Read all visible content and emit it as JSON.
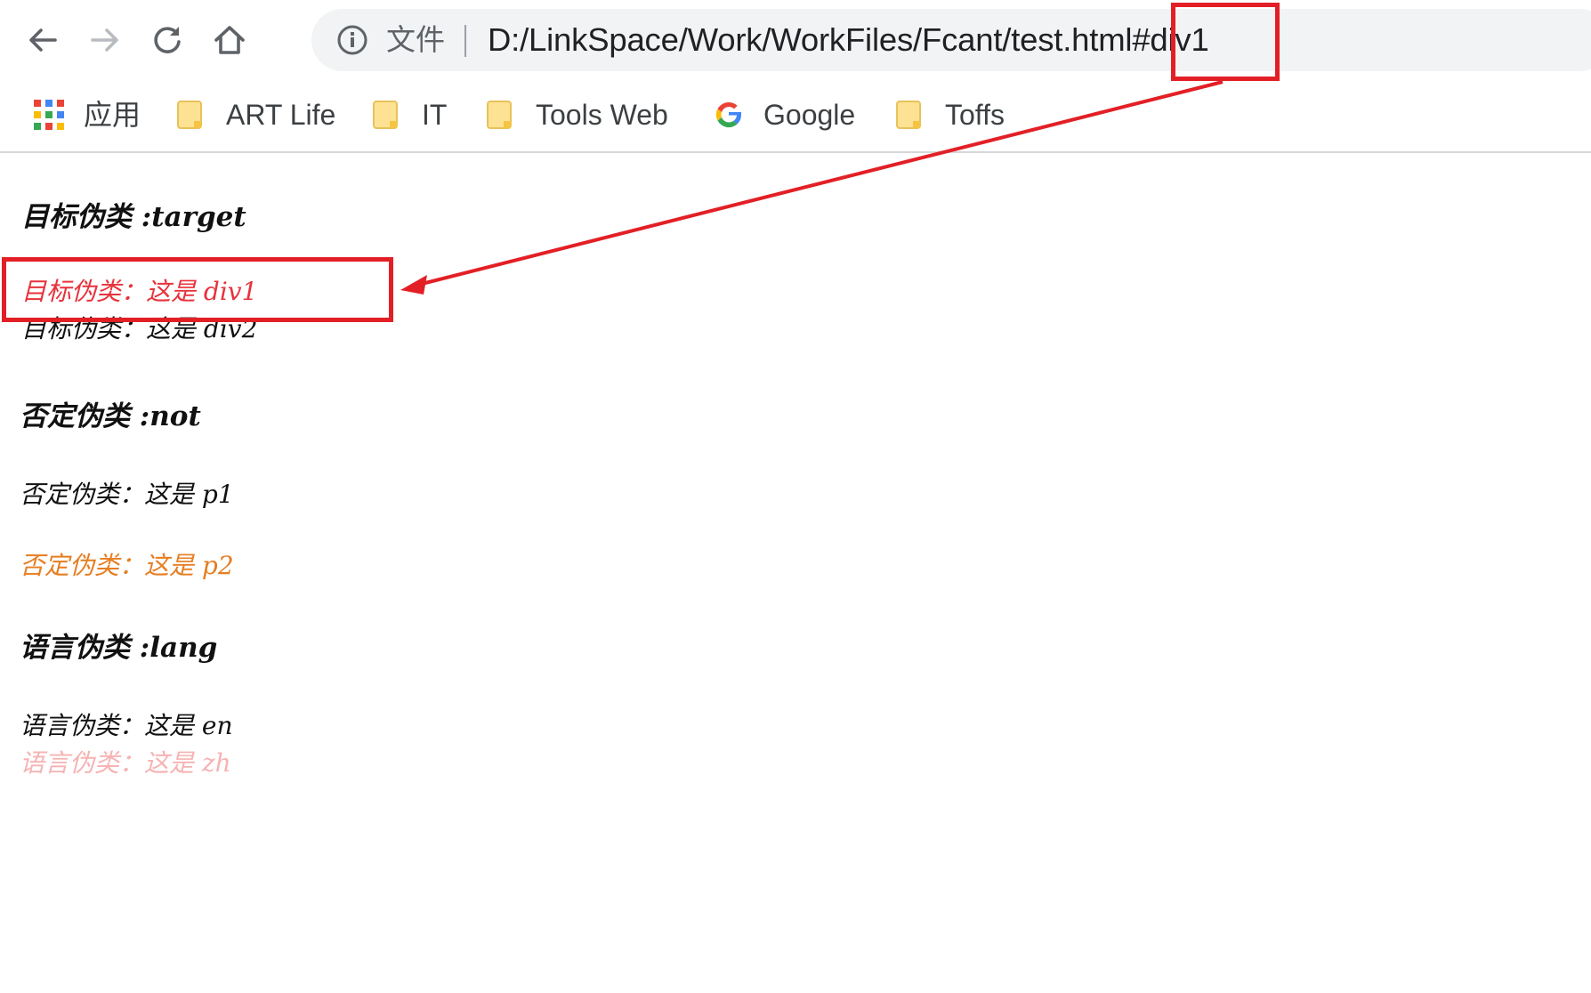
{
  "browser": {
    "address_bar": {
      "scheme_label": "文件",
      "url": "D:/LinkSpace/Work/WorkFiles/Fcant/test.html#div1"
    },
    "nav_icons": [
      "back-arrow-icon",
      "forward-arrow-icon",
      "reload-icon",
      "home-icon"
    ],
    "bookmarks": [
      {
        "label": "应用",
        "icon": "apps-grid-icon"
      },
      {
        "label": "ART Life",
        "icon": "folder-icon"
      },
      {
        "label": "IT",
        "icon": "folder-icon"
      },
      {
        "label": "Tools Web",
        "icon": "folder-icon"
      },
      {
        "label": "Google",
        "icon": "google-icon"
      },
      {
        "label": "Toffs",
        "icon": "folder-icon"
      }
    ]
  },
  "content": {
    "target_section": {
      "heading": "目标伪类 :target",
      "div1": "目标伪类：这是 div1",
      "div2": "目标伪类：这是 div2"
    },
    "not_section": {
      "heading": "否定伪类 :not",
      "p1": "否定伪类：这是 p1",
      "p2": "否定伪类：这是 p2"
    },
    "lang_section": {
      "heading": "语言伪类 :lang",
      "en": "语言伪类：这是 en",
      "zh": "语言伪类：这是 zh"
    }
  },
  "colors": {
    "annotation_red": "#e31f26",
    "target_text": "#e8323c",
    "not_text": "#e67e22",
    "lang_zh_text": "#f6b3b3"
  }
}
